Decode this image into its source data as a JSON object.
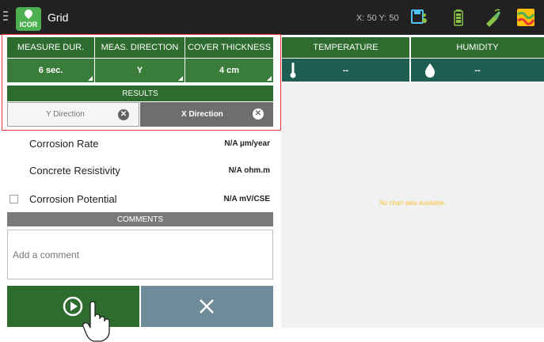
{
  "topbar": {
    "app_title": "Grid",
    "logo_text": "ICOR",
    "coords": "X: 50 Y: 50",
    "icons": [
      "menu-icon",
      "save-icon",
      "battery-icon",
      "probe-icon",
      "map-icon"
    ]
  },
  "settings": {
    "headers": [
      "MEASURE DUR.",
      "MEAS. DIRECTION",
      "COVER THICKNESS"
    ],
    "values": [
      "6 sec.",
      "Y",
      "4 cm"
    ]
  },
  "results": {
    "header": "RESULTS",
    "tabs": [
      {
        "label": "Y Direction",
        "selected": false
      },
      {
        "label": "X Direction",
        "selected": true
      }
    ]
  },
  "measurements": [
    {
      "label": "Corrosion Rate",
      "value": "N/A µm/year"
    },
    {
      "label": "Concrete Resistivity",
      "value": "N/A ohm.m"
    },
    {
      "label": "Corrosion Potential",
      "value": "N/A mV/CSE"
    }
  ],
  "comments": {
    "header": "COMMENTS",
    "placeholder": "Add a comment"
  },
  "sensors": {
    "headers": [
      "TEMPERATURE",
      "HUMIDITY"
    ],
    "values": [
      "--",
      "--"
    ]
  },
  "chart": {
    "empty_message": "No chart data available."
  },
  "colors": {
    "header_green": "#2e6b2e",
    "value_green": "#3a7d3a",
    "sensor_teal": "#1f5e52",
    "topbar": "#212121",
    "cancel_button": "#6f8a99",
    "annotation_red": "#e53935",
    "no_data_text": "#f9c23c"
  }
}
